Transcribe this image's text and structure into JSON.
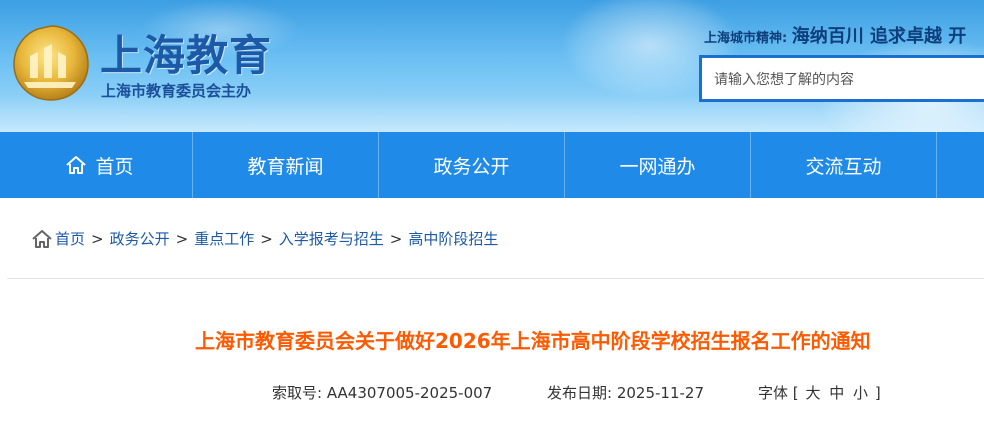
{
  "header": {
    "site_title": "上海教育",
    "site_subtitle": "上海市教育委员会主办",
    "logo_text": "上海",
    "spirit_label": "上海城市精神:",
    "spirit_text": "海纳百川 追求卓越 开",
    "search_placeholder": "请输入您想了解的内容"
  },
  "nav": {
    "items": [
      {
        "label": "首页",
        "icon": "home-icon"
      },
      {
        "label": "教育新闻"
      },
      {
        "label": "政务公开"
      },
      {
        "label": "一网通办"
      },
      {
        "label": "交流互动"
      }
    ]
  },
  "breadcrumb": {
    "icon": "home-icon",
    "items": [
      "首页",
      "政务公开",
      "重点工作",
      "入学报考与招生",
      "高中阶段招生"
    ],
    "separator": ">"
  },
  "article": {
    "title": "上海市教育委员会关于做好2026年上海市高中阶段学校招生报名工作的通知",
    "index_label": "索取号:",
    "index_value": "AA4307005-2025-007",
    "date_label": "发布日期:",
    "date_value": "2025-11-27",
    "font_label": "字体",
    "font_open": "[",
    "font_sizes": [
      "大",
      "中",
      "小"
    ],
    "font_close": "]"
  },
  "colors": {
    "nav_bg": "#1f8ae8",
    "title_orange": "#ff5a00",
    "link_blue": "#1c5aa8",
    "search_border": "#1b6fd0"
  }
}
